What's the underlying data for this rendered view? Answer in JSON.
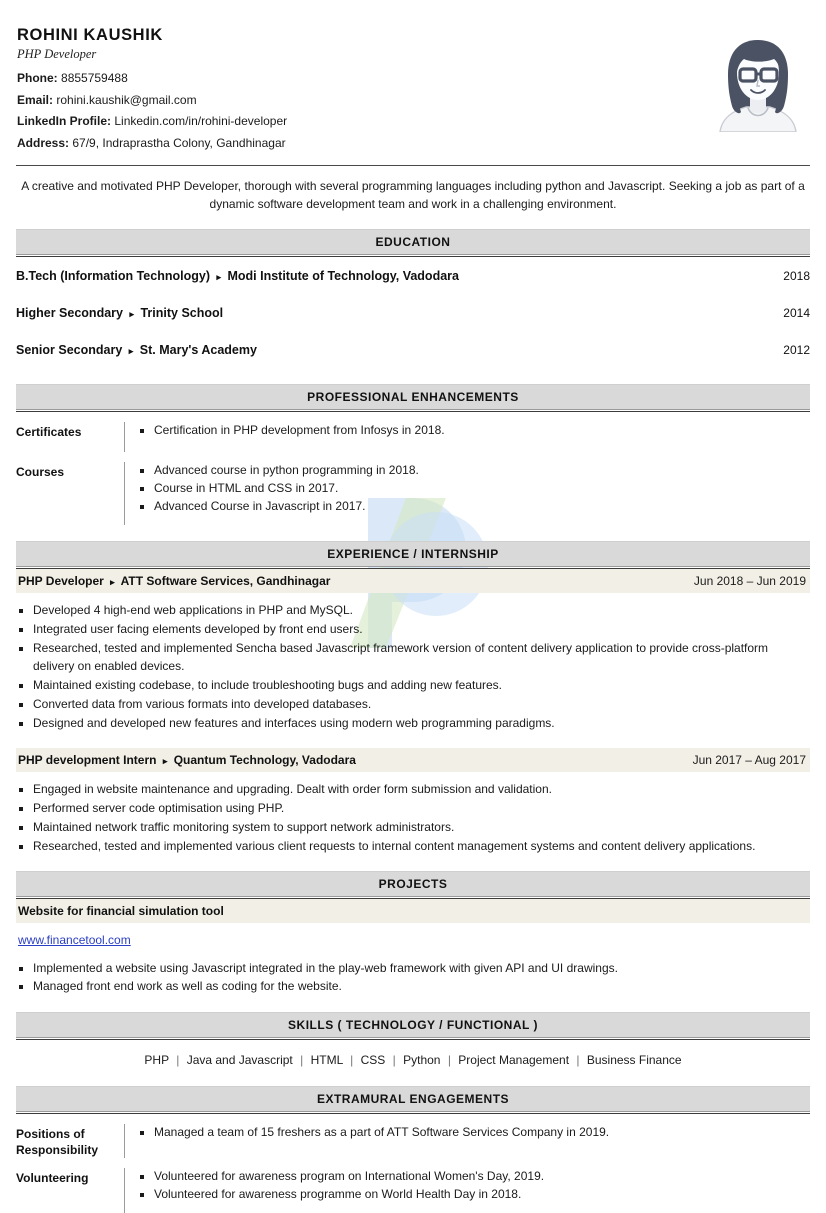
{
  "header": {
    "name": "ROHINI KAUSHIK",
    "role": "PHP Developer",
    "contacts": [
      {
        "label": "Phone:",
        "value": "8855759488"
      },
      {
        "label": "Email:",
        "value": "rohini.kaushik@gmail.com"
      },
      {
        "label": "LinkedIn Profile:",
        "value": "Linkedin.com/in/rohini-developer"
      },
      {
        "label": "Address:",
        "value": "67/9, Indraprastha Colony, Gandhinagar"
      }
    ],
    "avatar_alt": "avatar-illustration"
  },
  "summary": "A creative and motivated PHP Developer, thorough with several programming languages including python and Javascript. Seeking a job as part of a dynamic software development team and work in a challenging environment.",
  "sections": {
    "education": {
      "title": "EDUCATION",
      "rows": [
        {
          "degree": "B.Tech (Information Technology)",
          "institute": "Modi Institute of Technology, Vadodara",
          "year": "2018"
        },
        {
          "degree": "Higher Secondary",
          "institute": "Trinity School",
          "year": "2014"
        },
        {
          "degree": "Senior Secondary",
          "institute": "St. Mary's Academy",
          "year": "2012"
        }
      ]
    },
    "professional": {
      "title": "PROFESSIONAL ENHANCEMENTS",
      "groups": [
        {
          "label": "Certificates",
          "items": [
            "Certification in PHP development from Infosys in 2018."
          ]
        },
        {
          "label": "Courses",
          "items": [
            "Advanced course in python programming in 2018.",
            "Course in HTML and CSS in 2017.",
            "Advanced Course in Javascript in 2017."
          ]
        }
      ]
    },
    "experience": {
      "title": "EXPERIENCE / INTERNSHIP",
      "jobs": [
        {
          "position": "PHP Developer",
          "company": "ATT Software Services, Gandhinagar",
          "dates": "Jun 2018 – Jun 2019",
          "items": [
            "Developed 4 high-end web applications in PHP and MySQL.",
            "Integrated user facing elements developed by front end users.",
            "Researched, tested and implemented Sencha based Javascript framework version of content delivery application to provide cross-platform delivery on enabled devices.",
            "Maintained existing codebase, to include troubleshooting bugs and adding new features.",
            "Converted data from various formats into developed databases.",
            "Designed and developed new features and interfaces using modern web programming paradigms."
          ]
        },
        {
          "position": "PHP development Intern",
          "company": "Quantum Technology, Vadodara",
          "dates": "Jun 2017 – Aug 2017",
          "items": [
            "Engaged in website maintenance and upgrading. Dealt with order form submission and validation.",
            "Performed server code optimisation using PHP.",
            "Maintained network traffic monitoring system to support network administrators.",
            "Researched, tested and implemented various client requests to internal content management systems and content delivery applications."
          ]
        }
      ]
    },
    "projects": {
      "title": "PROJECTS",
      "name": "Website for financial simulation tool",
      "link": "www.financetool.com",
      "items": [
        "Implemented a website using Javascript integrated in the play-web framework with given API and UI drawings.",
        "Managed front end work as well as coding for the website."
      ]
    },
    "skills": {
      "title": "SKILLS ( TECHNOLOGY / FUNCTIONAL )",
      "items": [
        "PHP",
        "Java and Javascript",
        "HTML",
        "CSS",
        "Python",
        "Project Management",
        "Business Finance"
      ],
      "separator": "|"
    },
    "extramural": {
      "title": "EXTRAMURAL ENGAGEMENTS",
      "groups": [
        {
          "label": "Positions of Responsibility",
          "items": [
            "Managed a team of 15 freshers as a part of ATT Software Services Company in 2019."
          ]
        },
        {
          "label": "Volunteering",
          "items": [
            "Volunteered for awareness program on International Women's Day, 2019.",
            "Volunteered for awareness programme on World Health Day in 2018."
          ]
        }
      ]
    }
  },
  "colors": {
    "section_bar": "#d9d9d9",
    "entry_bar": "#f2efe6",
    "link": "#2b3fc4",
    "avatar": "#4a5263",
    "watermark_blue": "#c7dbf2",
    "watermark_green": "#cfe3c0"
  },
  "separators": {
    "triangle": "▸"
  }
}
